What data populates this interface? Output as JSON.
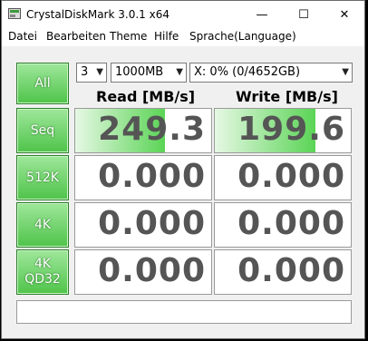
{
  "window": {
    "title": "CrystalDiskMark 3.0.1 x64"
  },
  "titlebar_buttons": {
    "minimize": "—",
    "maximize": "☐",
    "close": "✕"
  },
  "menu": [
    "Datei",
    "Bearbeiten",
    "Theme",
    "Hilfe",
    "Sprache(Language)"
  ],
  "controls": {
    "all_label": "All",
    "count": "3",
    "size": "1000MB",
    "drive": "X: 0% (0/4652GB)"
  },
  "headers": {
    "read": "Read [MB/s]",
    "write": "Write [MB/s]"
  },
  "tests": [
    {
      "label": "Seq",
      "read": "249.3",
      "write": "199.6",
      "read_fill": 0.66,
      "write_fill": 0.74
    },
    {
      "label": "512K",
      "read": "0.000",
      "write": "0.000",
      "read_fill": 0,
      "write_fill": 0
    },
    {
      "label": "4K",
      "read": "0.000",
      "write": "0.000",
      "read_fill": 0,
      "write_fill": 0
    },
    {
      "label": "4K QD32",
      "read": "0.000",
      "write": "0.000",
      "read_fill": 0,
      "write_fill": 0
    }
  ],
  "status_text": "",
  "colors": {
    "accent_green": "#4fc44a",
    "value_text": "#555555"
  }
}
